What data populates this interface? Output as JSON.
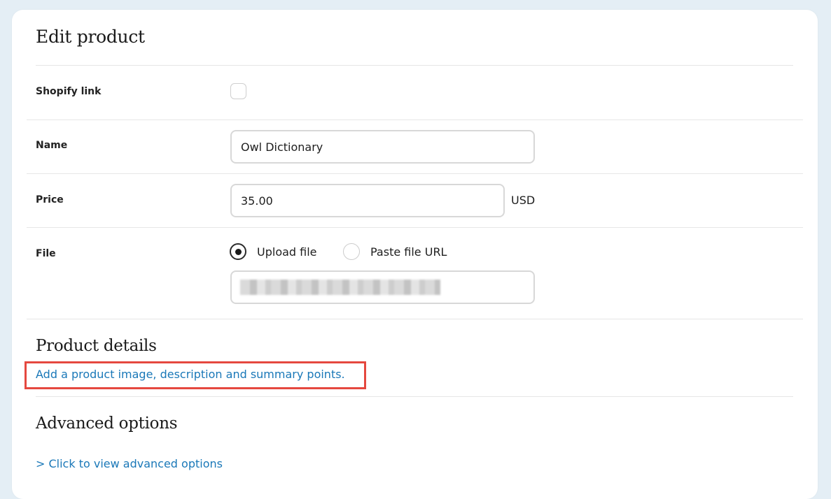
{
  "page": {
    "title": "Edit product"
  },
  "form": {
    "shopify_link": {
      "label": "Shopify link",
      "checked": false
    },
    "name": {
      "label": "Name",
      "value": "Owl Dictionary"
    },
    "price": {
      "label": "Price",
      "value": "35.00",
      "currency": "USD"
    },
    "file": {
      "label": "File",
      "options": [
        {
          "label": "Upload file",
          "selected": true
        },
        {
          "label": "Paste file URL",
          "selected": false
        }
      ]
    }
  },
  "product_details": {
    "heading": "Product details",
    "link": "Add a product image, description and summary points."
  },
  "advanced": {
    "heading": "Advanced options",
    "link": "> Click to view advanced options"
  },
  "colors": {
    "link": "#1a78b8",
    "highlight": "#e5483f",
    "background": "#e4eef5"
  }
}
